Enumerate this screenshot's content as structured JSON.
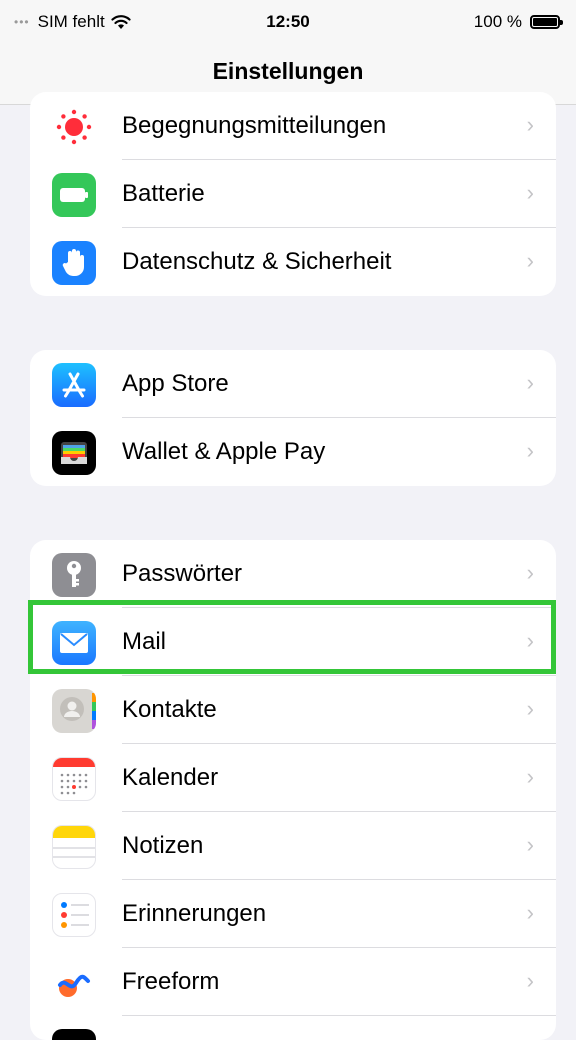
{
  "status_bar": {
    "carrier": "SIM fehlt",
    "time": "12:50",
    "battery": "100 %"
  },
  "nav": {
    "title": "Einstellungen"
  },
  "groups": [
    {
      "items": [
        {
          "label": "Begegnungsmitteilungen",
          "icon": "exposure-notification-icon"
        },
        {
          "label": "Batterie",
          "icon": "battery-icon"
        },
        {
          "label": "Datenschutz & Sicherheit",
          "icon": "hand-icon"
        }
      ]
    },
    {
      "items": [
        {
          "label": "App Store",
          "icon": "app-store-icon"
        },
        {
          "label": "Wallet & Apple Pay",
          "icon": "wallet-icon"
        }
      ]
    },
    {
      "items": [
        {
          "label": "Passwörter",
          "icon": "key-icon"
        },
        {
          "label": "Mail",
          "icon": "mail-icon"
        },
        {
          "label": "Kontakte",
          "icon": "contacts-icon"
        },
        {
          "label": "Kalender",
          "icon": "calendar-icon"
        },
        {
          "label": "Notizen",
          "icon": "notes-icon"
        },
        {
          "label": "Erinnerungen",
          "icon": "reminders-icon"
        },
        {
          "label": "Freeform",
          "icon": "freeform-icon"
        }
      ]
    }
  ],
  "highlight": {
    "target": "Mail",
    "color": "#34c638"
  },
  "chevron": "›"
}
